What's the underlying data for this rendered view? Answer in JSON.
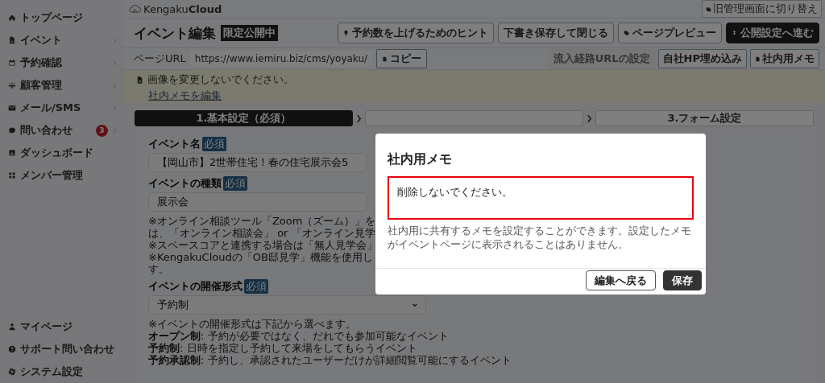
{
  "sidebar": {
    "items": [
      {
        "label": "トップページ",
        "has_submenu": false
      },
      {
        "label": "イベント",
        "has_submenu": true
      },
      {
        "label": "予約確認",
        "has_submenu": true
      },
      {
        "label": "顧客管理",
        "has_submenu": true
      },
      {
        "label": "メール/SMS",
        "has_submenu": true
      },
      {
        "label": "問い合わせ",
        "has_submenu": true,
        "badge": "3"
      },
      {
        "label": "ダッシュボード",
        "has_submenu": false
      },
      {
        "label": "メンバー管理",
        "has_submenu": false
      }
    ],
    "bottom_items": [
      {
        "label": "マイページ",
        "has_submenu": false
      },
      {
        "label": "サポート問い合わせ",
        "has_submenu": true
      },
      {
        "label": "システム設定",
        "has_submenu": false
      }
    ]
  },
  "header": {
    "logo": {
      "name": "Kengaku",
      "name_bold": "Cloud"
    },
    "switch_button": "旧管理画面に切り替え"
  },
  "page": {
    "title": "イベント編集",
    "status_badge": "限定公開中",
    "actions": [
      {
        "label": "予約数を上げるためのヒント",
        "kind": "outline"
      },
      {
        "label": "下書き保存して閉じる",
        "kind": "outline"
      },
      {
        "label": "ページプレビュー",
        "kind": "outline"
      },
      {
        "label": "公開設定へ進む",
        "kind": "primary"
      }
    ]
  },
  "url_bar": {
    "label": "ページURL",
    "url": "https://www.iemiru.biz/cms/yoyaku/",
    "copy_button": "コピー",
    "tools": [
      {
        "label": "流入経路URLの設定",
        "disabled": true
      },
      {
        "label": "自社HP埋め込み",
        "disabled": false
      },
      {
        "label": "社内用メモ",
        "disabled": false
      }
    ]
  },
  "memo_notice": {
    "text": "画像を変更しないでください。",
    "link": "社内メモを編集"
  },
  "steps": [
    {
      "label": "1.基本設定（必須）",
      "selected": true
    },
    {
      "selected": false
    },
    {
      "label": "3.フォーム設定",
      "selected": false
    }
  ],
  "form": {
    "fields": [
      {
        "label": "イベント名",
        "required": "必須",
        "kind": "input",
        "value": "【岡山市】2世帯住宅！春の住宅展示会5"
      },
      {
        "label": "イベントの種類",
        "required": "必須",
        "kind": "input",
        "value": "展示会",
        "notes": [
          "※オンライン相談ツール「Zoom（ズーム）」を",
          "は、「オンライン相談会」 or 「オンライン見学",
          "※スペースコアと連携する場合は「無人見学会」",
          "※KengakuCloudの「OB邸見学」機能を使用し",
          "す。"
        ]
      },
      {
        "label": "イベントの開催形式",
        "required": "必須",
        "kind": "select",
        "value": "予約制",
        "notes": [
          "※イベントの開催形式は下記から選べます。",
          "**オープン制**: 予約が必要ではなく、だれでも参加可能なイベント",
          "**予約制**: 日時を指定し予約して来場をしてもらうイベント",
          "**予約承認制**: 予約し、承認されたユーザーだけが詳細閲覧可能にするイベント"
        ]
      }
    ]
  },
  "modal": {
    "title": "社内用メモ",
    "memo": "削除しないでください。",
    "highlighted": true,
    "help": "社内用に共有するメモを設定することができます。設定したメモがイベントページに表示されることはありません。",
    "buttons": [
      {
        "label": "編集へ戻る",
        "kind": "secondary"
      },
      {
        "label": "保存",
        "kind": "primary"
      }
    ]
  }
}
